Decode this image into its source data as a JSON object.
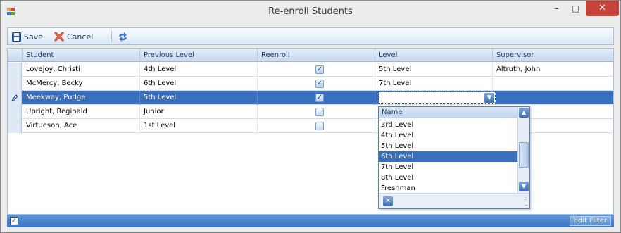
{
  "window": {
    "title": "Re-enroll Students",
    "minimize_glyph": "–",
    "maximize_glyph": "□",
    "close_glyph": "✕"
  },
  "toolbar": {
    "save_label": "Save",
    "cancel_label": "Cancel"
  },
  "grid": {
    "columns": [
      "Student",
      "Previous Level",
      "Reenroll",
      "Level",
      "Supervisor"
    ],
    "rows": [
      {
        "student": "Lovejoy, Christi",
        "previous_level": "4th Level",
        "reenroll": true,
        "level": "5th Level",
        "supervisor": "Altruth, John"
      },
      {
        "student": "McMercy, Becky",
        "previous_level": "6th Level",
        "reenroll": true,
        "level": "7th Level",
        "supervisor": ""
      },
      {
        "student": "Meekway, Pudge",
        "previous_level": "5th Level",
        "reenroll": true,
        "level": "",
        "supervisor": ""
      },
      {
        "student": "Upright, Reginald",
        "previous_level": "Junior",
        "reenroll": false,
        "level": "",
        "supervisor": ""
      },
      {
        "student": "Virtueson, Ace",
        "previous_level": "1st Level",
        "reenroll": false,
        "level": "",
        "supervisor": ""
      }
    ],
    "editing_row_index": 2
  },
  "dropdown": {
    "header": "Name",
    "items": [
      "3rd Level",
      "4th Level",
      "5th Level",
      "6th Level",
      "7th Level",
      "8th Level",
      "Freshman"
    ],
    "highlighted_item": "6th Level"
  },
  "footer": {
    "edit_filter_label": "Edit Filter",
    "filter_enabled": true
  },
  "colors": {
    "selection": "#3a6fbf",
    "close_button": "#c7433a",
    "footer": "#4a85cf"
  }
}
